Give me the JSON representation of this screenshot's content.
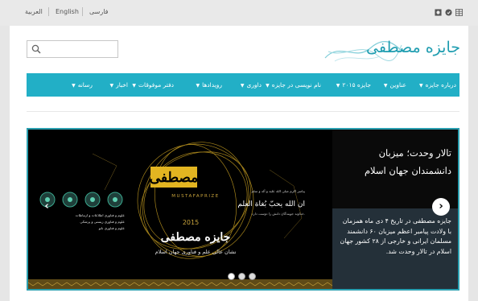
{
  "top_bar": {
    "languages": [
      {
        "label": "العربية"
      },
      {
        "label": "English"
      },
      {
        "label": "فارسی"
      }
    ],
    "social_icons": [
      "camera-icon",
      "circle-icon",
      "grid-icon"
    ]
  },
  "header": {
    "logo_text": "جایزه مصطفی",
    "search": {
      "placeholder": "",
      "value": ""
    }
  },
  "nav": {
    "items": [
      {
        "label": "درباره جایزه"
      },
      {
        "label": "عناوین"
      },
      {
        "label": "جایزه ۲۰۱۵"
      },
      {
        "label": "نام نویسی در جایزه"
      },
      {
        "label": "داوری"
      },
      {
        "label": "رویدادها"
      },
      {
        "label": "دفتر موفوقات"
      },
      {
        "label": "اخبار"
      },
      {
        "label": "رسانه"
      }
    ]
  },
  "slider": {
    "title": "تالار وحدت؛ میزبان دانشمندان جهان اسلام",
    "description": "جایزه مصطفی در تاریخ ۴ دی ماه همزمان با ولادت پیامبر اعظم میزبان ۶۰ دانشمند مسلمان ایرانی و خارجی از ۲۸ کشور جهان اسلام در تالار وحدت شد.",
    "dots": [
      {
        "active": true
      },
      {
        "active": false
      },
      {
        "active": false
      }
    ],
    "poster": {
      "year": "2015",
      "prize_name": "جایزه مصطفی",
      "brand_latin": "MUSTAFAPRIZE",
      "subtitle": "نشان عالی علم و فناوری جهان اسلام",
      "hadith_small": "پیامبر اکرم صلی الله علیه و آله و سلم",
      "hadith": "ان الله یحبّ بُغاة العلم",
      "hadith_translation": "خداوند جویندگان دانش را دوست دارد.",
      "field_lines": [
        "علوم و فناوری اطلاعات و ارتباطات",
        "علوم و فناوری زیستی و پزشکی",
        "علوم و فناوری نانو"
      ]
    }
  }
}
